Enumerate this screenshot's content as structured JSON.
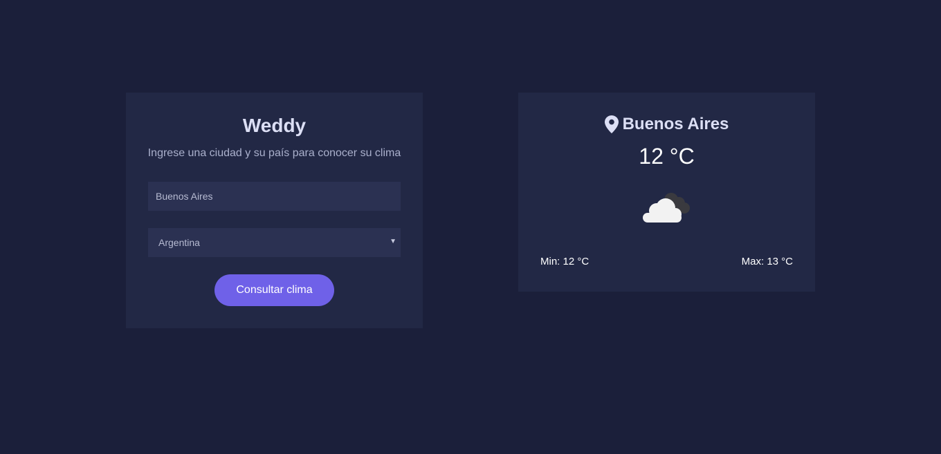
{
  "search": {
    "title": "Weddy",
    "subtitle": "Ingrese una ciudad y su país para conocer su clima",
    "city_value": "Buenos Aires",
    "country_selected": "Argentina",
    "submit_label": "Consultar clima"
  },
  "weather": {
    "city": "Buenos Aires",
    "temperature": "12 °C",
    "condition_icon": "cloud-icon",
    "min_text": "Min: 12 °C",
    "max_text": "Max: 13 °C"
  },
  "colors": {
    "background": "#1b1f3a",
    "card": "#222845",
    "input": "#2b3152",
    "accent": "#6f61e8"
  }
}
